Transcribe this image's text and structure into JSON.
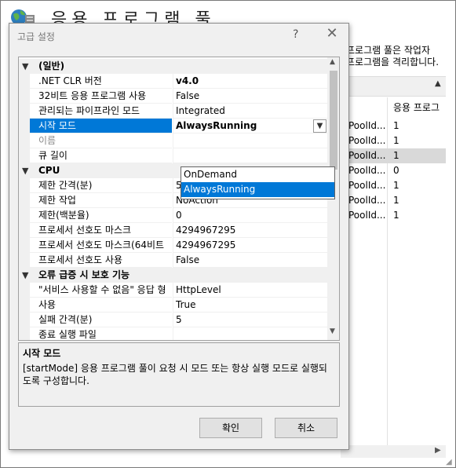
{
  "background_window": {
    "title": "응용 프로그램 풀",
    "description_lines": [
      "프로그램 풀은 작업자",
      "프로그램을 격리합니다."
    ],
    "column_header": "응용 프로그",
    "rows": [
      {
        "name": "PoolId...",
        "value": "1"
      },
      {
        "name": "PoolId...",
        "value": "1"
      },
      {
        "name": "PoolId...",
        "value": "1"
      },
      {
        "name": "PoolId...",
        "value": "0"
      },
      {
        "name": "PoolId...",
        "value": "1"
      },
      {
        "name": "PoolId...",
        "value": "1"
      },
      {
        "name": "PoolId...",
        "value": "1"
      }
    ]
  },
  "dialog": {
    "title": "고급 설정",
    "help_label": "?",
    "close_label": "✕",
    "ok_label": "확인",
    "cancel_label": "취소"
  },
  "grid": {
    "cat_general": "(일반)",
    "clr_version": {
      "name": ".NET CLR 버전",
      "value": "v4.0"
    },
    "enable32": {
      "name": "32비트 응용 프로그램 사용",
      "value": "False"
    },
    "pipeline": {
      "name": "관리되는 파이프라인 모드",
      "value": "Integrated"
    },
    "start_mode": {
      "name": "시작 모드",
      "value": "AlwaysRunning"
    },
    "pool_name": {
      "name": "이름",
      "value": ""
    },
    "queue_length": {
      "name": "큐 길이",
      "value": ""
    },
    "cat_cpu": "CPU",
    "cpu_interval": {
      "name": "제한 간격(분)",
      "value": "5"
    },
    "cpu_action": {
      "name": "제한 작업",
      "value": "NoAction"
    },
    "cpu_limit": {
      "name": "제한(백분율)",
      "value": "0"
    },
    "affinity_mask": {
      "name": "프로세서 선호도 마스크",
      "value": "4294967295"
    },
    "affinity_mask64": {
      "name": "프로세서 선호도 마스크(64비트",
      "value": "4294967295"
    },
    "affinity_enabled": {
      "name": "프로세서 선호도 사용",
      "value": "False"
    },
    "cat_rapidfail": "오류 급증 시 보호 기능",
    "service_unavailable": {
      "name": "\"서비스 사용할 수 없음\" 응답 형",
      "value": "HttpLevel"
    },
    "rf_enabled": {
      "name": "사용",
      "value": "True"
    },
    "rf_interval": {
      "name": "실패 간격(분)",
      "value": "5"
    },
    "rf_exe": {
      "name": "종료 실행 파일",
      "value": ""
    }
  },
  "dropdown": {
    "options": [
      "OnDemand",
      "AlwaysRunning"
    ],
    "selected": "AlwaysRunning"
  },
  "description": {
    "title": "시작 모드",
    "text": "[startMode] 응용 프로그램 풀이 요청 시 모드 또는 항상 실행 모드로 실행되도록 구성합니다."
  }
}
